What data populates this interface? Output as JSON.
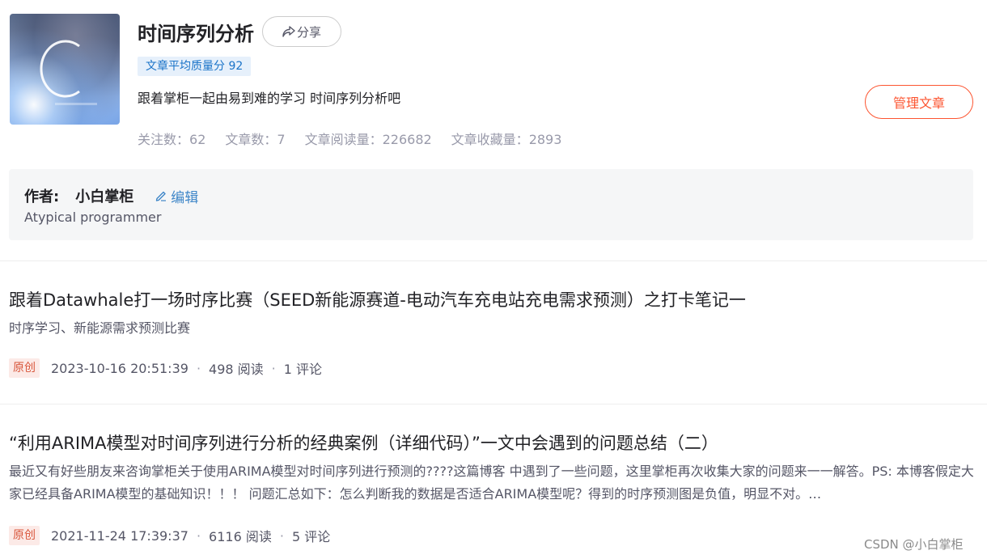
{
  "column": {
    "title": "时间序列分析",
    "share_label": "分享",
    "quality_badge": "文章平均质量分 92",
    "description": "跟着掌柜一起由易到难的学习 时间序列分析吧",
    "manage_label": "管理文章",
    "stats": [
      {
        "label": "关注数：",
        "value": "62"
      },
      {
        "label": "文章数：",
        "value": "7"
      },
      {
        "label": "文章阅读量：",
        "value": "226682"
      },
      {
        "label": "文章收藏量：",
        "value": "2893"
      }
    ]
  },
  "author": {
    "label": "作者:",
    "name": "小白掌柜",
    "edit_label": "编辑",
    "bio": "Atypical programmer"
  },
  "articles": [
    {
      "title": "跟着Datawhale打一场时序比赛（SEED新能源赛道-电动汽车充电站充电需求预测）之打卡笔记一",
      "desc": "时序学习、新能源需求预测比赛",
      "tag": "原创",
      "date": "2023-10-16 20:51:39",
      "reads": "498 阅读",
      "comments": "1 评论"
    },
    {
      "title": "“利用ARIMA模型对时间序列进行分析的经典案例（详细代码）”一文中会遇到的问题总结（二）",
      "desc": "最近又有好些朋友来咨询掌柜关于使用ARIMA模型对时间序列进行预测的????这篇博客 中遇到了一些问题，这里掌柜再次收集大家的问题来一一解答。PS: 本博客假定大家已经具备ARIMA模型的基础知识！！！ 问题汇总如下：怎么判断我的数据是否适合ARIMA模型呢？得到的时序预测图是负值，明显不对。…",
      "tag": "原创",
      "date": "2021-11-24 17:39:37",
      "reads": "6116 阅读",
      "comments": "5 评论"
    }
  ],
  "watermark": "CSDN @小白掌柜",
  "colors": {
    "accent": "#fc5531",
    "badge_bg": "#e6f0fb",
    "badge_text": "#1a73c8",
    "link": "#3e86c8",
    "muted": "#999aaa"
  },
  "icons": {
    "share": "share-arrow-icon",
    "edit": "pencil-icon"
  }
}
